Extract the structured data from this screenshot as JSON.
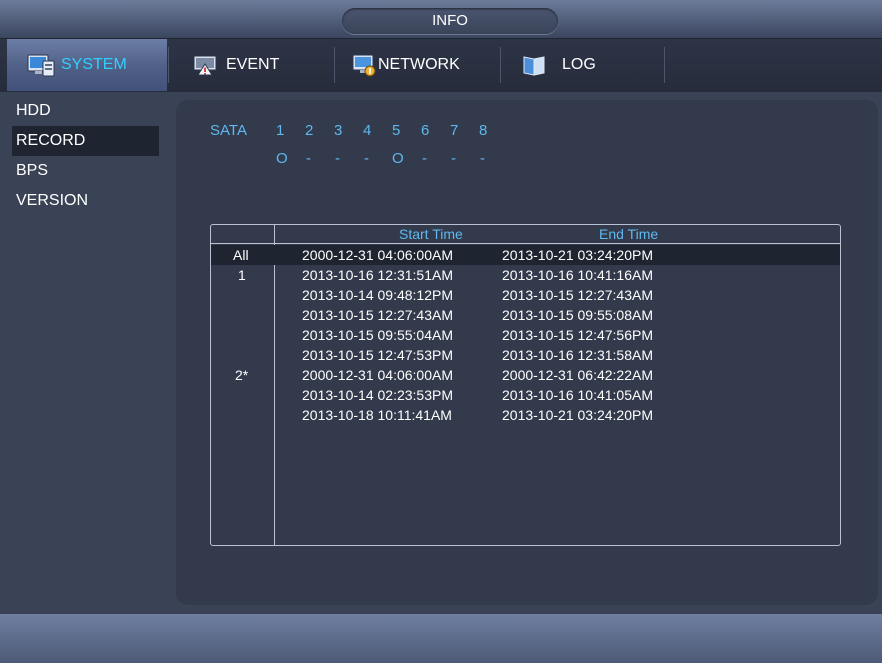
{
  "window": {
    "title": "INFO"
  },
  "tabs": [
    {
      "label": "SYSTEM",
      "icon": "monitor-icon",
      "active": true
    },
    {
      "label": "EVENT",
      "icon": "event-icon",
      "active": false
    },
    {
      "label": "NETWORK",
      "icon": "network-icon",
      "active": false
    },
    {
      "label": "LOG",
      "icon": "log-icon",
      "active": false
    }
  ],
  "sidebar": {
    "items": [
      {
        "label": "HDD"
      },
      {
        "label": "RECORD",
        "active": true
      },
      {
        "label": "BPS"
      },
      {
        "label": "VERSION"
      }
    ]
  },
  "sata": {
    "label": "SATA",
    "ports": [
      "1",
      "2",
      "3",
      "4",
      "5",
      "6",
      "7",
      "8"
    ],
    "status": [
      "O",
      "-",
      "-",
      "-",
      "O",
      "-",
      "-",
      "-"
    ]
  },
  "record_table": {
    "headers": {
      "start": "Start Time",
      "end": "End Time"
    },
    "rows": [
      {
        "disk": "All",
        "start": "2000-12-31 04:06:00AM",
        "end": "2013-10-21 03:24:20PM"
      },
      {
        "disk": "1",
        "start": "2013-10-16 12:31:51AM",
        "end": "2013-10-16 10:41:16AM"
      },
      {
        "disk": "",
        "start": "2013-10-14 09:48:12PM",
        "end": "2013-10-15 12:27:43AM"
      },
      {
        "disk": "",
        "start": "2013-10-15 12:27:43AM",
        "end": "2013-10-15 09:55:08AM"
      },
      {
        "disk": "",
        "start": "2013-10-15 09:55:04AM",
        "end": "2013-10-15 12:47:56PM"
      },
      {
        "disk": "",
        "start": "2013-10-15 12:47:53PM",
        "end": "2013-10-16 12:31:58AM"
      },
      {
        "disk": "2*",
        "start": "2000-12-31 04:06:00AM",
        "end": "2000-12-31 06:42:22AM"
      },
      {
        "disk": "",
        "start": "2013-10-14 02:23:53PM",
        "end": "2013-10-16 10:41:05AM"
      },
      {
        "disk": "",
        "start": "2013-10-18 10:11:41AM",
        "end": "2013-10-21 03:24:20PM"
      }
    ]
  },
  "colors": {
    "accent": "#2fd0ff",
    "info_text": "#5fb8ee"
  }
}
